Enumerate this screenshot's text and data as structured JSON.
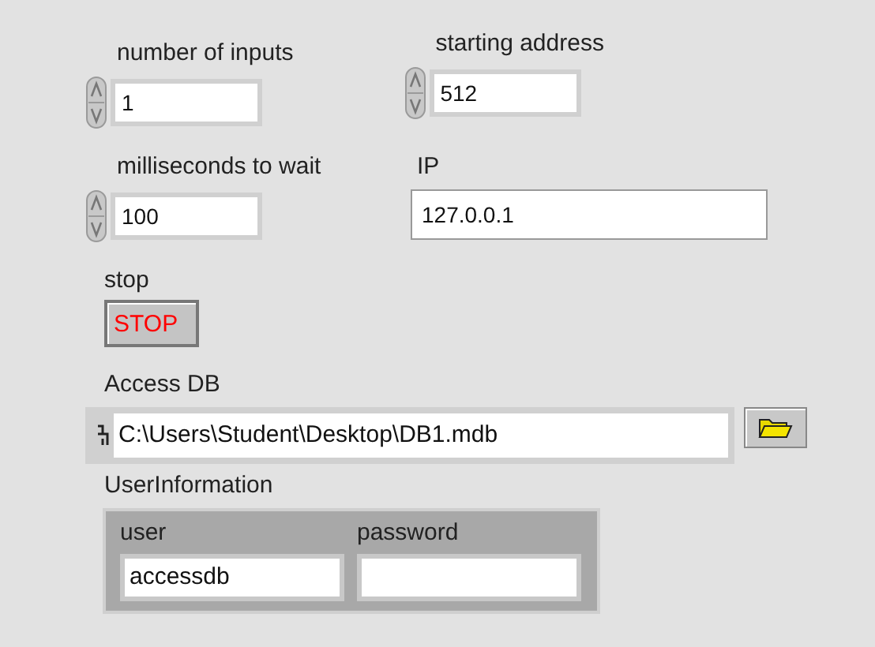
{
  "numerics_row_1": [
    {
      "label": "number of inputs",
      "value": "1"
    },
    {
      "label": "starting address",
      "value": "512"
    }
  ],
  "wait": {
    "label": "milliseconds to wait",
    "value": "100"
  },
  "ip": {
    "label": "IP",
    "value": "127.0.0.1"
  },
  "stop": {
    "label": "stop",
    "button": "STOP"
  },
  "path": {
    "label": "Access DB",
    "value": "C:\\Users\\Student\\Desktop\\DB1.mdb"
  },
  "cluster": {
    "label": "UserInformation",
    "fields": [
      {
        "label": "user",
        "value": "accessdb"
      },
      {
        "label": "password"
      }
    ]
  }
}
